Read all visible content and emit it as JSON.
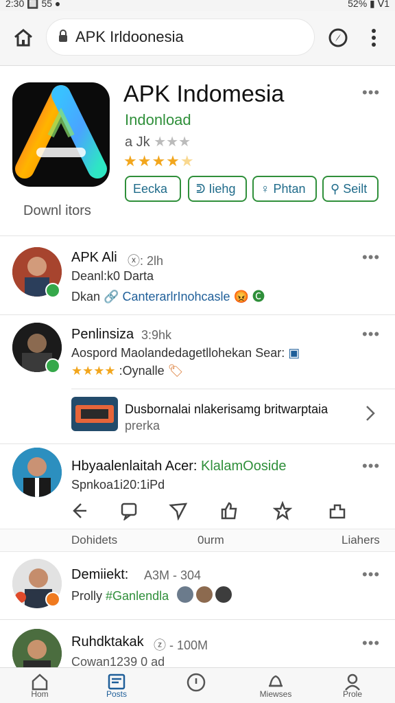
{
  "status": {
    "left": "2:30 🔲 55 ●",
    "right": "52% ▮ ᐯ1"
  },
  "browser": {
    "url": "APK Irldoonesia"
  },
  "app": {
    "title": "APK Indomesia",
    "developer": "Indonload",
    "rating_text": "a Jk",
    "downloads_label": "Downl itors",
    "chips": [
      "Eecka",
      "Iiehg",
      "Phtan",
      "Seilt"
    ]
  },
  "feed": [
    {
      "name": "APK Ali",
      "meta": "2lh",
      "line1": "Deanl:k0 Darta",
      "line2a": "Dkan",
      "line2b": "CanterarlrInohcasle"
    },
    {
      "name": "Penlinsiza",
      "meta": "3:9hk",
      "line1": "Aospord Maolandedagetllohekan Sear:",
      "line2": ":Oynalle"
    },
    {
      "name": "Dusbornalai nlakerisamg britwarptaia",
      "meta": "prerka"
    },
    {
      "name": "Hbyaalenlaitah Acer:",
      "name2": "KlalamOoside",
      "line1": "Spnkoa1i20:1iPd"
    },
    {
      "name": "Demiiekt:",
      "meta": "A3M - 304",
      "line1": "Prolly",
      "line1b": "#Ganlendla"
    },
    {
      "name": "Ruhdktakak",
      "meta": "100M",
      "line1": "Cowan1239 0 ad"
    }
  ],
  "tabs": {
    "left": "Dohidets",
    "center": "0urm",
    "right": "Liahers"
  },
  "bottom_nav": [
    "Hom",
    "Posts",
    "",
    "Miewses",
    "Prole"
  ],
  "colors": {
    "green": "#2f8f3a",
    "blue": "#1f5f99",
    "star": "#f2a61d"
  }
}
